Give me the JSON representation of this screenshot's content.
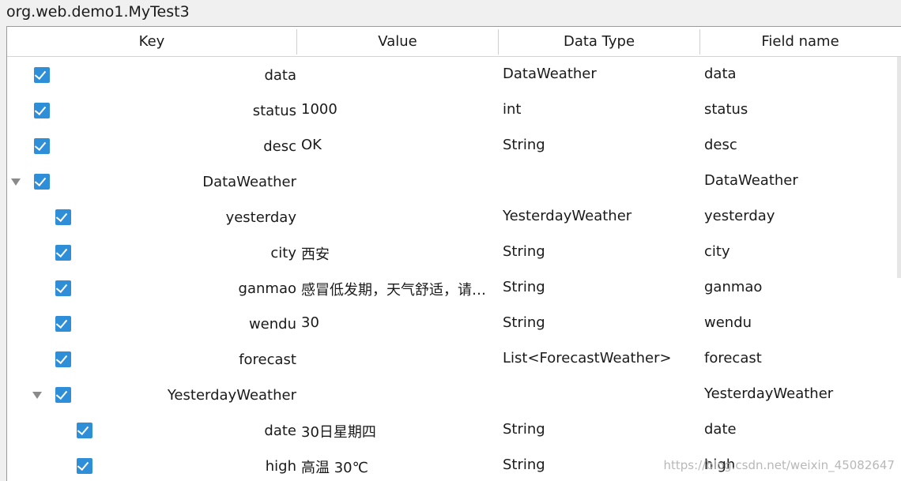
{
  "window": {
    "title": "org.web.demo1.MyTest3"
  },
  "columns": {
    "key": "Key",
    "value": "Value",
    "data_type": "Data Type",
    "field_name": "Field name"
  },
  "rows": [
    {
      "key": "data",
      "value": "",
      "type": "DataWeather",
      "field": "data",
      "checked": true,
      "level": 0,
      "expandable": false
    },
    {
      "key": "status",
      "value": "1000",
      "type": "int",
      "field": "status",
      "checked": true,
      "level": 0,
      "expandable": false
    },
    {
      "key": "desc",
      "value": "OK",
      "type": "String",
      "field": "desc",
      "checked": true,
      "level": 0,
      "expandable": false
    },
    {
      "key": "DataWeather",
      "value": "",
      "type": "",
      "field": "DataWeather",
      "checked": true,
      "level": 0,
      "expandable": true
    },
    {
      "key": "yesterday",
      "value": "",
      "type": "YesterdayWeather",
      "field": "yesterday",
      "checked": true,
      "level": 1,
      "expandable": false
    },
    {
      "key": "city",
      "value": "西安",
      "type": "String",
      "field": "city",
      "checked": true,
      "level": 1,
      "expandable": false
    },
    {
      "key": "ganmao",
      "value": "感冒低发期，天气舒适，请注…",
      "type": "String",
      "field": "ganmao",
      "checked": true,
      "level": 1,
      "expandable": false
    },
    {
      "key": "wendu",
      "value": "30",
      "type": "String",
      "field": "wendu",
      "checked": true,
      "level": 1,
      "expandable": false
    },
    {
      "key": "forecast",
      "value": "",
      "type": "List<ForecastWeather>",
      "field": "forecast",
      "checked": true,
      "level": 1,
      "expandable": false
    },
    {
      "key": "YesterdayWeather",
      "value": "",
      "type": "",
      "field": "YesterdayWeather",
      "checked": true,
      "level": 1,
      "expandable": true
    },
    {
      "key": "date",
      "value": "30日星期四",
      "type": "String",
      "field": "date",
      "checked": true,
      "level": 2,
      "expandable": false
    },
    {
      "key": "high",
      "value": "高温 30℃",
      "type": "String",
      "field": "high",
      "checked": true,
      "level": 2,
      "expandable": false
    }
  ],
  "watermark": "https://blog.csdn.net/weixin_45082647",
  "colors": {
    "checkbox": "#2f8ed8",
    "caret": "#8a8a8a"
  }
}
